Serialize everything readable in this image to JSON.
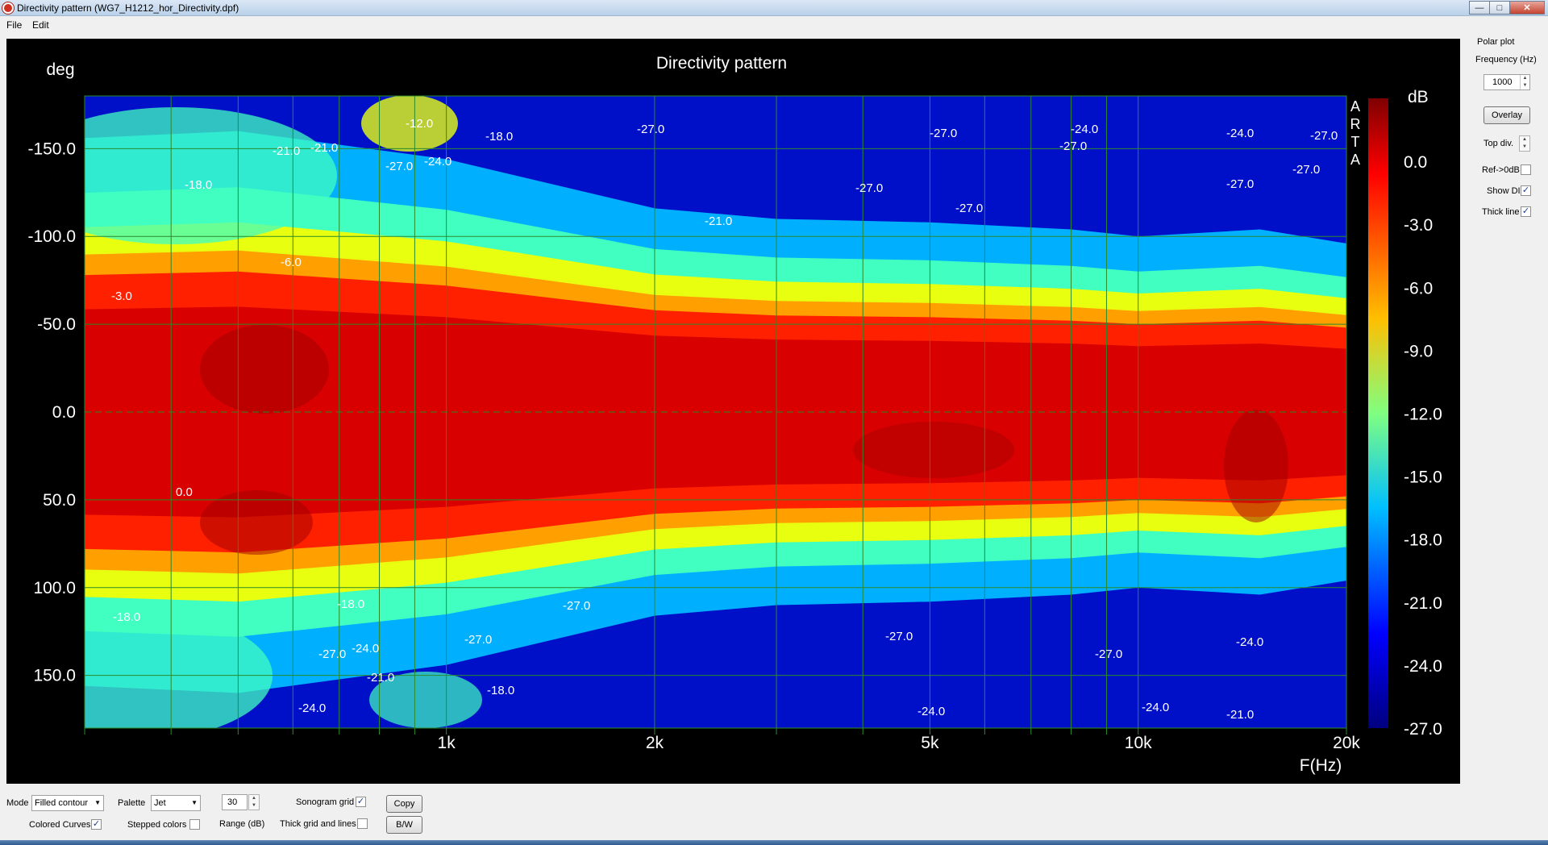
{
  "window": {
    "title": "Directivity pattern (WG7_H1212_hor_Directivity.dpf)"
  },
  "menu": [
    "File",
    "Edit"
  ],
  "plot": {
    "title": "Directivity pattern",
    "y_unit_label": "deg",
    "x_unit_label": "F(Hz)",
    "colorbar_label": "dB",
    "watermark": "ARTA",
    "colorbar_ticks": [
      "0.0",
      "-3.0",
      "-6.0",
      "-9.0",
      "-12.0",
      "-15.0",
      "-18.0",
      "-21.0",
      "-24.0",
      "-27.0"
    ],
    "contour_labels": [
      "-27.0",
      "-24.0",
      "-21.0",
      "-18.0",
      "-12.0",
      "-6.0",
      "-3.0",
      "0.0"
    ]
  },
  "chart_data": {
    "type": "heatmap",
    "title": "Directivity pattern",
    "xlabel": "F(Hz)",
    "ylabel": "deg",
    "x_scale": "log",
    "xlim": [
      300,
      20000
    ],
    "ylim": [
      -180,
      180
    ],
    "x_ticks": [
      {
        "value": 1000,
        "label": "1k"
      },
      {
        "value": 2000,
        "label": "2k"
      },
      {
        "value": 5000,
        "label": "5k"
      },
      {
        "value": 10000,
        "label": "10k"
      },
      {
        "value": 20000,
        "label": "20k"
      }
    ],
    "y_ticks": [
      {
        "value": -150,
        "label": "-150.0"
      },
      {
        "value": -100,
        "label": "-100.0"
      },
      {
        "value": -50,
        "label": "-50.0"
      },
      {
        "value": 0,
        "label": "0.0"
      },
      {
        "value": 50,
        "label": "50.0"
      },
      {
        "value": 100,
        "label": "100.0"
      },
      {
        "value": 150,
        "label": "150.0"
      }
    ],
    "colorbar": {
      "label": "dB",
      "range": [
        -27,
        3
      ],
      "palette": "Jet"
    },
    "minus6dB_halfwidth_deg": [
      {
        "f": 300,
        "deg": 78
      },
      {
        "f": 500,
        "deg": 80
      },
      {
        "f": 1000,
        "deg": 72
      },
      {
        "f": 2000,
        "deg": 58
      },
      {
        "f": 3000,
        "deg": 55
      },
      {
        "f": 5000,
        "deg": 54
      },
      {
        "f": 8000,
        "deg": 52
      },
      {
        "f": 10000,
        "deg": 50
      },
      {
        "f": 15000,
        "deg": 52
      },
      {
        "f": 20000,
        "deg": 48
      }
    ],
    "grid": true,
    "legend": "colorbar right"
  },
  "polar": {
    "title": "Polar plot",
    "freq_label": "Frequency (Hz)",
    "freq_value": "1000",
    "overlay_button": "Overlay",
    "topdiv_label": "Top div.",
    "ref_label": "Ref->0dB",
    "showdi_label": "Show DI",
    "thick_label": "Thick line"
  },
  "controls": {
    "mode_label": "Mode",
    "mode_value": "Filled contour",
    "palette_label": "Palette",
    "palette_value": "Jet",
    "range_value": "30",
    "range_label": "Range (dB)",
    "sonogram_label": "Sonogram grid",
    "copy_button": "Copy",
    "colored_label": "Colored Curves",
    "stepped_label": "Stepped colors",
    "thickgrid_label": "Thick grid and  lines",
    "bw_button": "B/W"
  },
  "colors": {
    "plot_bg": "#000000",
    "grid": "#2a8a2a",
    "text": "#ffffff"
  }
}
